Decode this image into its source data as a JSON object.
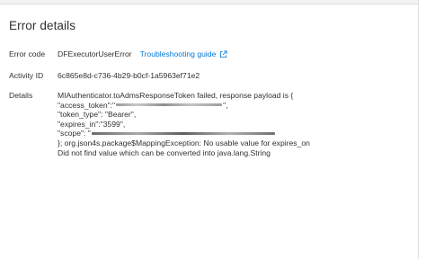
{
  "panel": {
    "title": "Error details"
  },
  "error_code": {
    "label": "Error code",
    "value": "DFExecutorUserError",
    "link_label": "Troubleshooting guide",
    "link_icon": "external-link-icon"
  },
  "activity_id": {
    "label": "Activity ID",
    "value": "6c865e8d-c736-4b29-b0cf-1a5963ef71e2"
  },
  "details": {
    "label": "Details",
    "lines": {
      "l1": "MIAuthenticator.toAdmsResponseToken failed, response payload is {",
      "l2_prefix": "\"access_token\":\"",
      "l2_suffix": "\",",
      "l3": "\"token_type\": \"Bearer\",",
      "l4": "\"expires_in\":\"3599\",",
      "l5_prefix": "\"scope\": \"",
      "l6": "}; org.json4s.package$MappingException: No usable value for expires_on",
      "l7": "Did not find value which can be converted into java.lang.String"
    }
  }
}
